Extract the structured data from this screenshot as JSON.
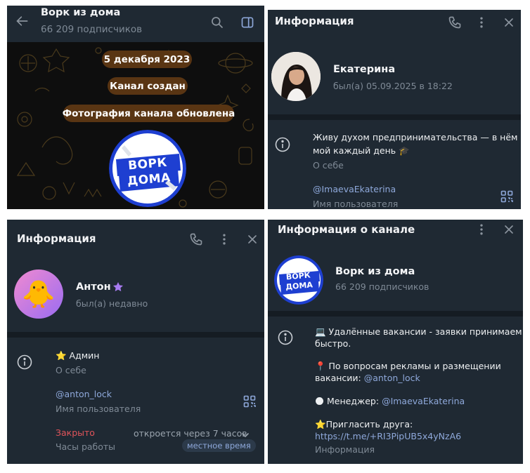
{
  "channel_view": {
    "title": "Ворк из дома",
    "subscribers": "66 209 подписчиков",
    "service_messages": [
      "5 декабря 2023",
      "Канал создан",
      "Фотография канала обновлена"
    ],
    "logo_text": "ВОРК ДОМА"
  },
  "profile_ekaterina": {
    "header_title": "Информация",
    "name": "Екатерина",
    "last_seen": "был(а) 05.09.2025 в 18:22",
    "bio_line1": "Живу духом предпринимательства — в нём",
    "bio_line2": "мой каждый день 🎓",
    "bio_label": "О себе",
    "username": "@ImaevaEkaterina",
    "username_label": "Имя пользователя"
  },
  "profile_anton": {
    "header_title": "Информация",
    "name": "Антон",
    "avatar_emoji": "🐥",
    "last_seen": "был(а) недавно",
    "bio": "⭐ Админ",
    "bio_label": "О себе",
    "username": "@anton_lock",
    "username_label": "Имя пользователя",
    "hours_status": "Закрыто",
    "hours_next": "откроется через 7 часов",
    "hours_label": "Часы работы",
    "hours_badge": "местное время"
  },
  "channel_info": {
    "header_title": "Информация о канале",
    "name": "Ворк из дома",
    "subscribers": "66 209 подписчиков",
    "desc_line1": "💻 Удалённые вакансии - заявки принимаем",
    "desc_line2": "быстро.",
    "ads_line1": "📍 По вопросам рекламы и размещении",
    "ads_line2_prefix": "вакансии: ",
    "ads_link": "@anton_lock",
    "manager_prefix": "🌑 Менеджер: ",
    "manager_link": "@ImaevaEkaterina",
    "invite": "⭐Пригласить друга:",
    "invite_link": "https://t.me/+RI3PipUB5x4yNzA6",
    "info_label": "Информация",
    "logo_text": "ВОРК ДОМА"
  },
  "colors": {
    "panel_bg": "#1f2933",
    "separator": "#151c23",
    "link": "#8ea8da",
    "muted": "#7f8a96",
    "closed_red": "#e0545a",
    "service_pill": "#593513",
    "logo_blue": "#1e3fd1"
  },
  "icons": [
    "back-arrow-icon",
    "search-icon",
    "sidebar-icon",
    "phone-icon",
    "more-icon",
    "close-icon",
    "info-icon",
    "qr-code-icon",
    "premium-star-icon",
    "chevron-down-icon"
  ]
}
